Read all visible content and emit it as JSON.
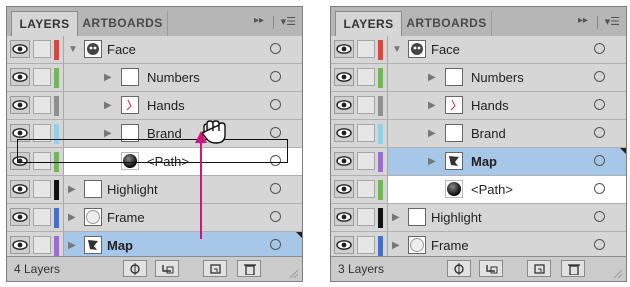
{
  "colors": {
    "panel_bg": "#d6d6d6",
    "selected_row": "#a7c7e8",
    "drag_arrow": "#d0157d",
    "layer_colors": [
      "#e0433a",
      "#6dbb4e",
      "#8f8f8f",
      "#8ed3ee",
      "#6dbb4e",
      "#111111",
      "#3f6fd4",
      "#9c6cd6"
    ]
  },
  "icons": {
    "visibility": "eye-icon",
    "expand": "disclosure-triangle-icon",
    "target": "target-circle-icon",
    "locate": "locate-object-icon",
    "clipping": "make-clipping-mask-icon",
    "new_sublayer": "new-sublayer-icon",
    "new_layer": "new-layer-icon",
    "trash": "trash-icon",
    "menu": "panel-menu-icon",
    "collapse": "collapse-panel-icon",
    "drag": "hand-grab-icon"
  },
  "before": {
    "tabs": [
      {
        "label": "LAYERS"
      },
      {
        "label": "ARTBOARDS"
      }
    ],
    "rows": [
      {
        "name": "Face"
      },
      {
        "name": "Numbers"
      },
      {
        "name": "Hands"
      },
      {
        "name": "Brand"
      },
      {
        "name": "<Path>"
      },
      {
        "name": "Highlight"
      },
      {
        "name": "Frame"
      },
      {
        "name": "Map"
      }
    ],
    "footer": {
      "count": "4 Layers"
    }
  },
  "after": {
    "tabs": [
      {
        "label": "LAYERS"
      },
      {
        "label": "ARTBOARDS"
      }
    ],
    "rows": [
      {
        "name": "Face"
      },
      {
        "name": "Numbers"
      },
      {
        "name": "Hands"
      },
      {
        "name": "Brand"
      },
      {
        "name": "Map"
      },
      {
        "name": "<Path>"
      },
      {
        "name": "Highlight"
      },
      {
        "name": "Frame"
      }
    ],
    "footer": {
      "count": "3 Layers"
    }
  }
}
